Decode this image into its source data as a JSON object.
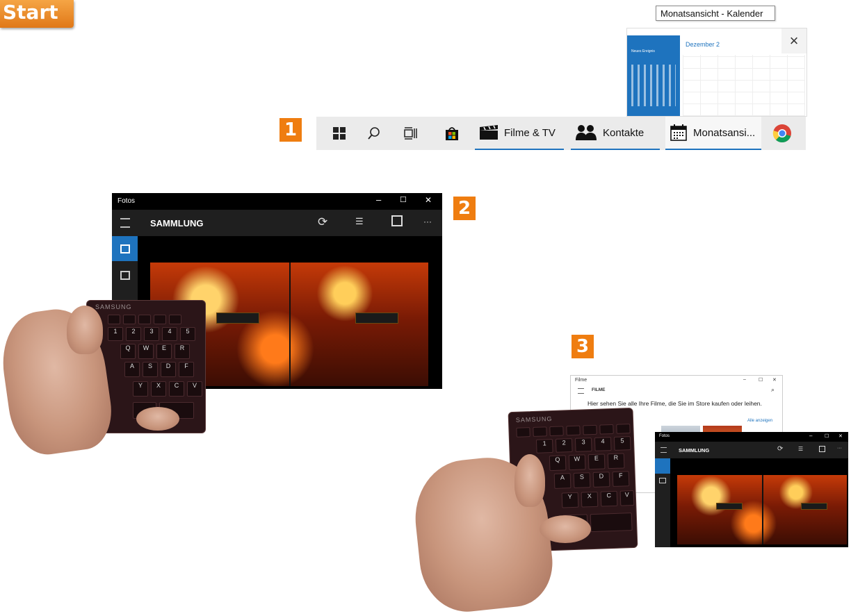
{
  "start_badge": "Start",
  "steps": {
    "one": "1",
    "two": "2",
    "three": "3"
  },
  "tooltip": "Monatsansicht - Kalender",
  "calendar_preview": {
    "sidebar_title": "Neues Ereignis",
    "month_header": "Dezember 2",
    "close_glyph": "×"
  },
  "taskbar": {
    "items": [
      {
        "icon": "windows-icon"
      },
      {
        "icon": "search-icon"
      },
      {
        "icon": "task-view-icon"
      },
      {
        "icon": "store-icon"
      },
      {
        "icon": "clapperboard-icon",
        "label": "Filme & TV"
      },
      {
        "icon": "contacts-icon",
        "label": "Kontakte"
      },
      {
        "icon": "calendar-icon",
        "label": "Monatsansi..."
      },
      {
        "icon": "chrome-icon"
      }
    ]
  },
  "fotos_window": {
    "title": "Fotos",
    "section": "SAMMLUNG",
    "controls": {
      "minimize": "–",
      "maximize": "☐",
      "close": "✕"
    },
    "more": "···"
  },
  "filme_window": {
    "title": "Filme",
    "section": "FILME",
    "text": "Hier sehen Sie alle Ihre Filme, die Sie im Store kaufen oder leihen.",
    "link": "Alle anzeigen",
    "controls": {
      "minimize": "–",
      "maximize": "☐",
      "close": "✕"
    }
  },
  "fotos_small": {
    "title": "Fotos",
    "section": "SAMMLUNG"
  },
  "keyboard": {
    "brand": "SAMSUNG",
    "keys_row1": [
      "!",
      "\"",
      "§",
      "$",
      "%"
    ],
    "keys_row2": [
      "1",
      "2",
      "3",
      "4",
      "5"
    ],
    "keys_row3": [
      "Q",
      "W",
      "E",
      "R"
    ],
    "keys_row4": [
      "A",
      "S",
      "D",
      "F"
    ],
    "keys_row5": [
      "Y",
      "X",
      "C",
      "V"
    ]
  },
  "colors": {
    "accent_orange": "#ef7d10",
    "windows_blue": "#1e73be",
    "taskbar_bg": "#ebebeb"
  }
}
